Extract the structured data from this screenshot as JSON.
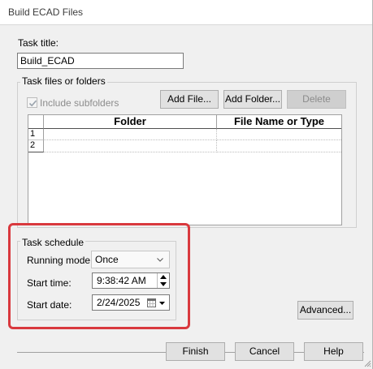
{
  "window": {
    "title": "Build ECAD Files"
  },
  "task_title": {
    "label": "Task title:",
    "value": "Build_ECAD"
  },
  "task_files": {
    "label": "Task files or folders",
    "include_subfolders_label": "Include subfolders",
    "include_subfolders_checked": true,
    "add_file_label": "Add File...",
    "add_folder_label": "Add Folder...",
    "delete_label": "Delete",
    "grid": {
      "columns": [
        "Folder",
        "File Name or Type"
      ],
      "rows": [
        {
          "num": "1",
          "folder": "",
          "file": ""
        },
        {
          "num": "2",
          "folder": "",
          "file": ""
        }
      ]
    }
  },
  "schedule": {
    "label": "Task schedule",
    "running_mode_label": "Running mode:",
    "running_mode_value": "Once",
    "start_time_label": "Start time:",
    "start_time_value": "9:38:42 AM",
    "start_date_label": "Start date:",
    "start_date_value": "2/24/2025"
  },
  "buttons": {
    "advanced": "Advanced...",
    "finish": "Finish",
    "cancel": "Cancel",
    "help": "Help"
  },
  "colors": {
    "highlight": "#d9393e",
    "accent_check": "#9aa3ad"
  }
}
